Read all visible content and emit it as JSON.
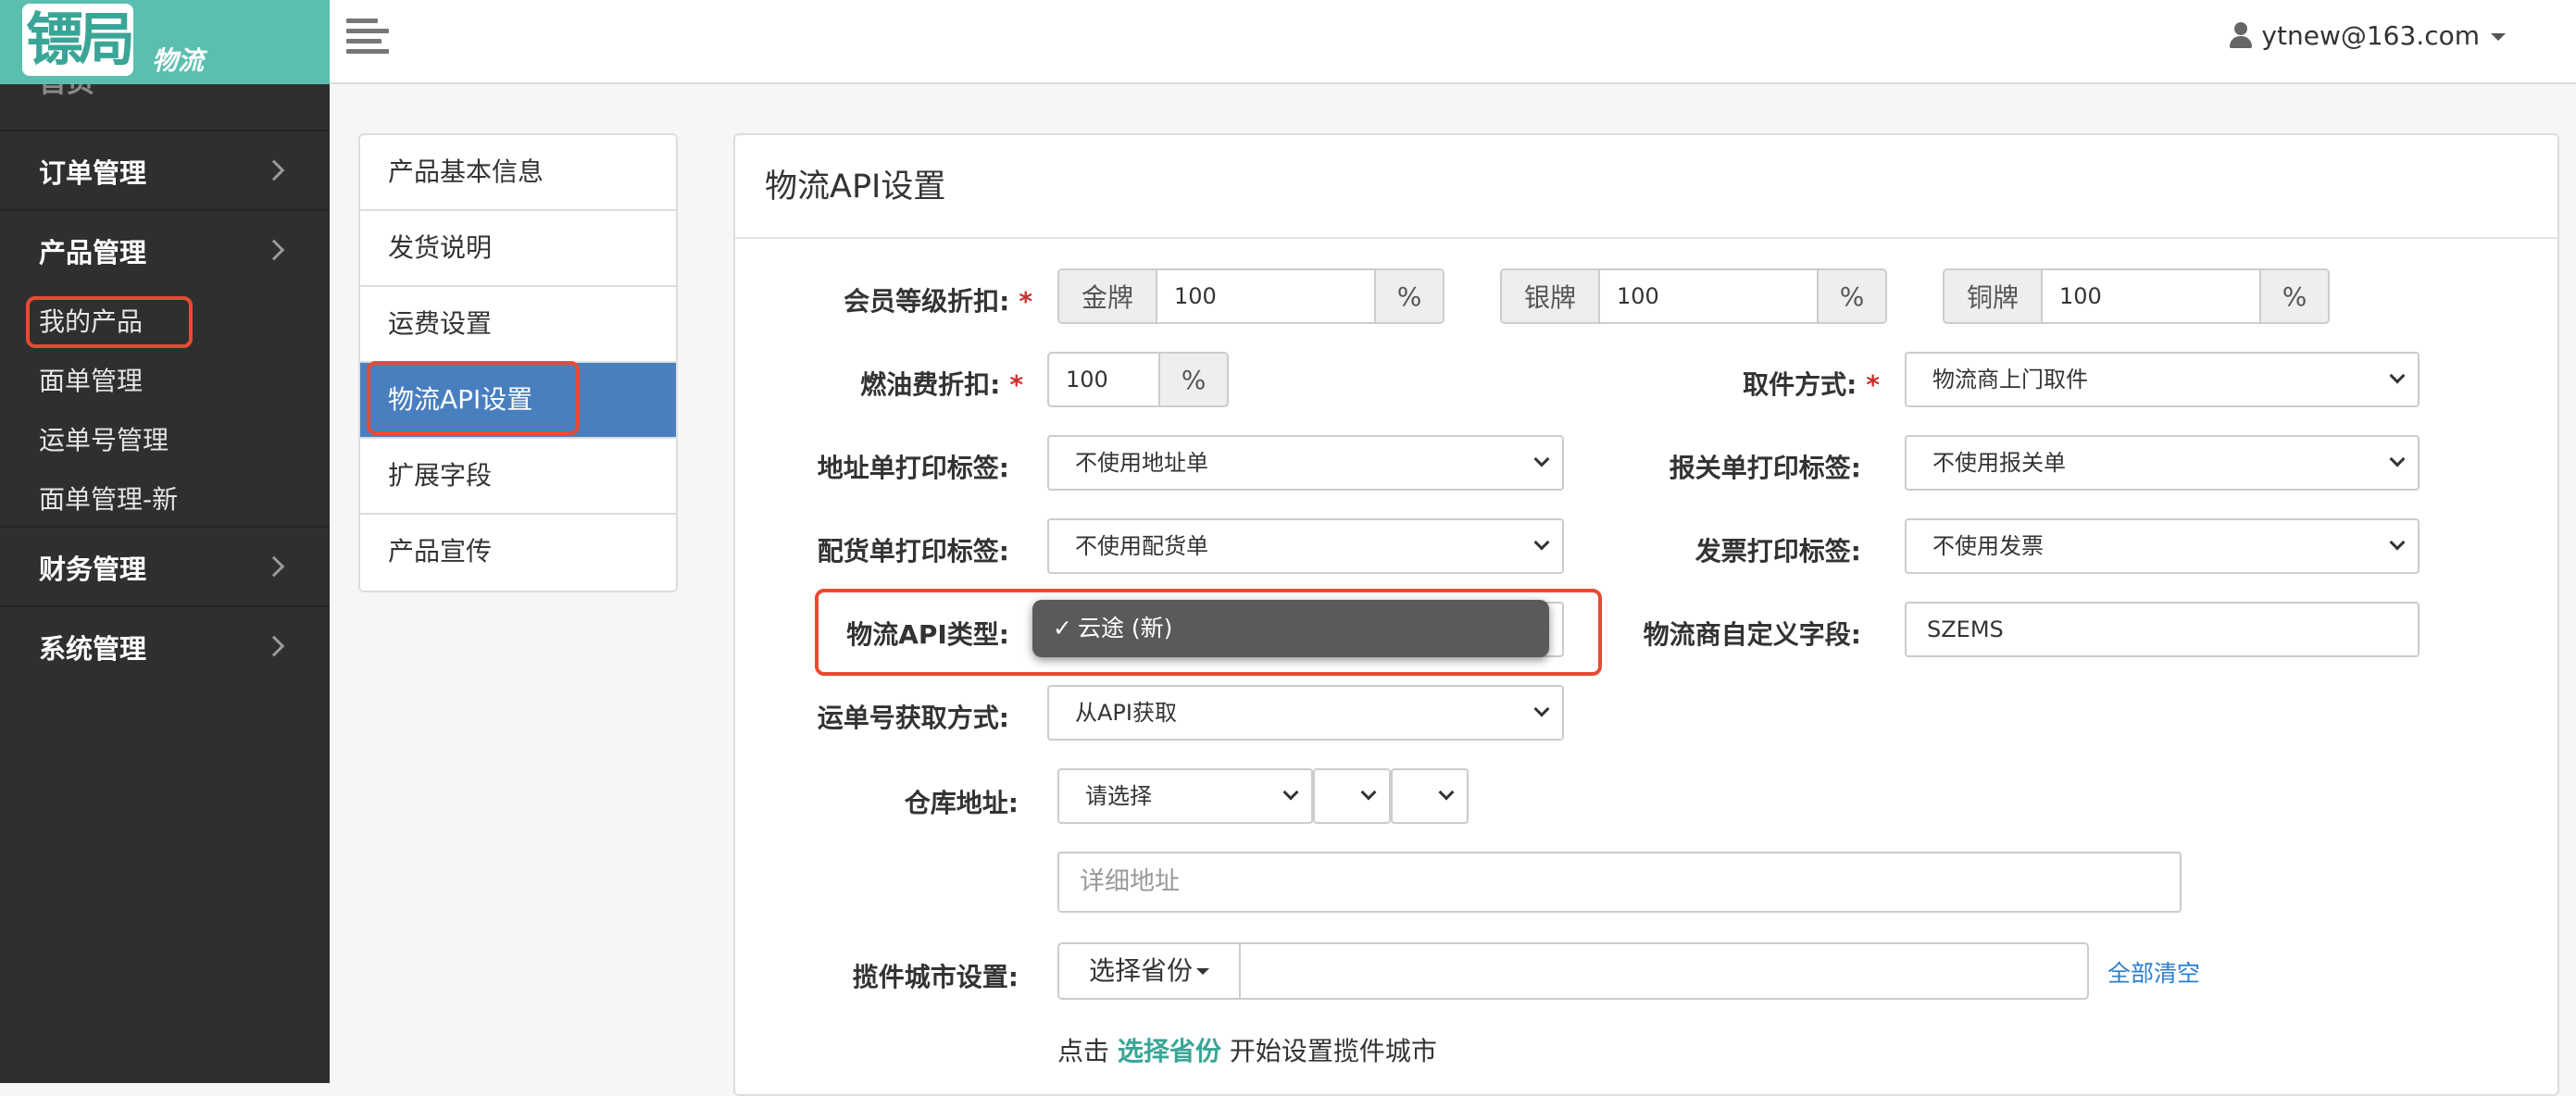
{
  "app": {
    "logo_text": "镖局",
    "logo_sub": "物流"
  },
  "topbar": {
    "user_email": "ytnew@163.com"
  },
  "sidebar": {
    "ghost_item": "首页",
    "groups": [
      {
        "label": "订单管理"
      },
      {
        "label": "产品管理"
      },
      {
        "label": "财务管理"
      },
      {
        "label": "系统管理"
      }
    ],
    "product_subitems": [
      {
        "label": "我的产品"
      },
      {
        "label": "面单管理"
      },
      {
        "label": "运单号管理"
      },
      {
        "label": "面单管理-新"
      }
    ]
  },
  "tabs": [
    {
      "label": "产品基本信息"
    },
    {
      "label": "发货说明"
    },
    {
      "label": "运费设置"
    },
    {
      "label": "物流API设置"
    },
    {
      "label": "扩展字段"
    },
    {
      "label": "产品宣传"
    }
  ],
  "panel": {
    "title": "物流API设置"
  },
  "form": {
    "member_discount": {
      "label": "会员等级折扣:",
      "required": "*",
      "gold": {
        "prefix": "金牌",
        "value": "100",
        "suffix": "%"
      },
      "silver": {
        "prefix": "银牌",
        "value": "100",
        "suffix": "%"
      },
      "bronze": {
        "prefix": "铜牌",
        "value": "100",
        "suffix": "%"
      }
    },
    "fuel_discount": {
      "label": "燃油费折扣:",
      "required": "*",
      "value": "100",
      "suffix": "%"
    },
    "pickup_method": {
      "label": "取件方式:",
      "required": "*",
      "value": "物流商上门取件"
    },
    "address_label": {
      "label": "地址单打印标签:",
      "value": "不使用地址单"
    },
    "customs_label": {
      "label": "报关单打印标签:",
      "value": "不使用报关单"
    },
    "picking_label": {
      "label": "配货单打印标签:",
      "value": "不使用配货单"
    },
    "invoice_label": {
      "label": "发票打印标签:",
      "value": "不使用发票"
    },
    "api_type": {
      "label": "物流API类型:",
      "check": "✓",
      "value": "云途 (新)"
    },
    "custom_field": {
      "label": "物流商自定义字段:",
      "value": "SZEMS"
    },
    "waybill_method": {
      "label": "运单号获取方式:",
      "value": "从API获取"
    },
    "warehouse": {
      "label": "仓库地址:",
      "province": "请选择",
      "city": "",
      "district": "",
      "detail_placeholder": "详细地址"
    },
    "pickup_city": {
      "label": "揽件城市设置:",
      "button": "选择省份",
      "clear_link": "全部清空"
    },
    "hint": {
      "pre": "点击",
      "link": "选择省份",
      "post": "开始设置揽件城市"
    }
  },
  "colors": {
    "logo_bg": "#5bbfb0",
    "sidebar_bg": "#2f2f2f",
    "active_tab": "#4a7fbf",
    "highlight_box": "#e84a33",
    "link": "#2a7fd0",
    "required": "#c9302c"
  },
  "icons": [
    "menu-icon",
    "user-icon",
    "caret-down-icon",
    "chevron-right-icon",
    "select-arrow-icon",
    "check-icon"
  ]
}
